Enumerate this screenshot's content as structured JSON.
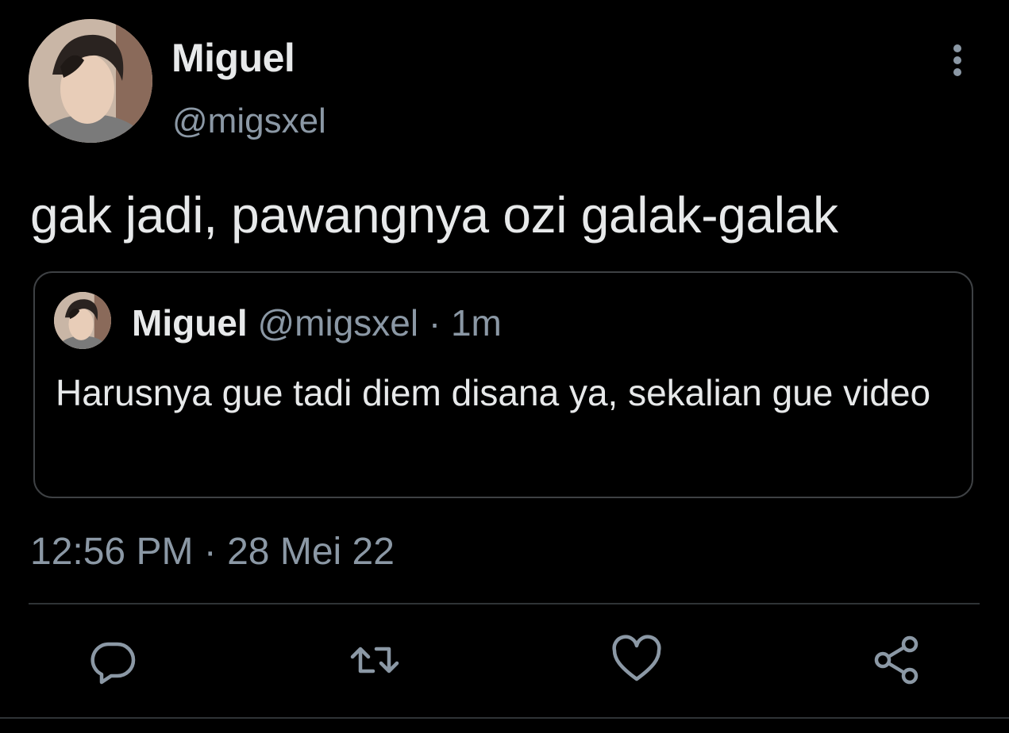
{
  "tweet": {
    "author": {
      "display_name": "Miguel",
      "handle": "@migsxel"
    },
    "text": "gak jadi, pawangnya ozi galak-galak",
    "timestamp": "12:56 PM · 28 Mei 22",
    "more_icon": "more-vertical-icon"
  },
  "quoted_tweet": {
    "display_name": "Miguel",
    "handle": "@migsxel",
    "separator": " · ",
    "time": "1m",
    "text": "Harusnya gue tadi diem disana ya, sekalian gue video"
  },
  "actions": [
    {
      "name": "reply",
      "icon": "reply-icon"
    },
    {
      "name": "retweet",
      "icon": "retweet-icon"
    },
    {
      "name": "like",
      "icon": "heart-icon"
    },
    {
      "name": "share",
      "icon": "share-icon"
    }
  ],
  "colors": {
    "background": "#000000",
    "primary_text": "#e7e9ea",
    "secondary_text": "#8b98a5",
    "border": "#3e4144"
  }
}
